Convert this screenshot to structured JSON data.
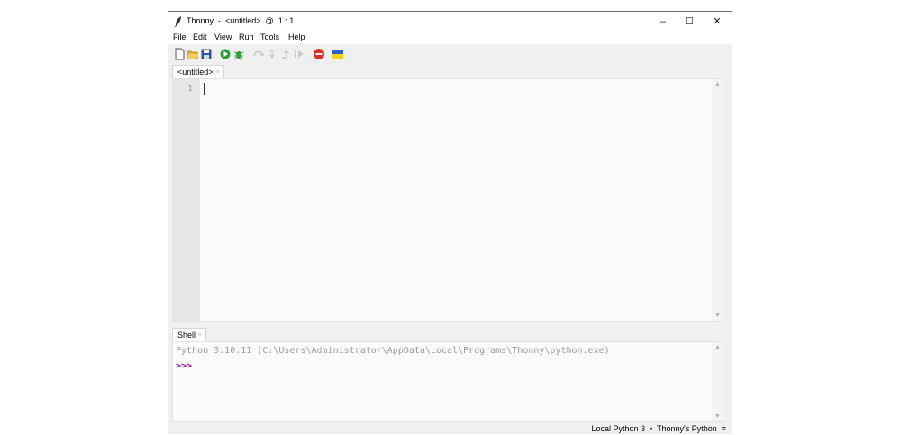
{
  "window": {
    "title": "Thonny  -  <untitled>  @  1 : 1",
    "minimize_glyph": "–",
    "maximize_glyph": "☐",
    "close_glyph": "✕"
  },
  "menu": {
    "items": [
      {
        "label": "File"
      },
      {
        "label": "Edit"
      },
      {
        "label": "View"
      },
      {
        "label": "Run"
      },
      {
        "label": "Tools"
      },
      {
        "label": "Help"
      }
    ]
  },
  "toolbar": {
    "icons": [
      "new-file-icon",
      "open-folder-icon",
      "save-icon",
      "run-icon",
      "debug-icon",
      "step-over-icon",
      "step-into-icon",
      "step-out-icon",
      "resume-icon",
      "stop-icon",
      "ukraine-flag-icon"
    ],
    "colors": {
      "run": "#2e9e3a",
      "stop": "#d9322b",
      "flag_blue": "#2f62c9",
      "flag_yellow": "#f5d10f"
    }
  },
  "editor": {
    "tab_label": "<untitled>",
    "tab_close": "×",
    "line_numbers": [
      "1"
    ]
  },
  "shell": {
    "tab_label": "Shell",
    "tab_close": "×",
    "banner": "Python 3.10.11 (C:\\Users\\Administrator\\AppData\\Local\\Programs\\Thonny\\python.exe)",
    "prompt": ">>>",
    "prompt_color": "#8b1a8b"
  },
  "status": {
    "interpreter": "Local Python 3  •  Thonny's Python  ≡"
  }
}
